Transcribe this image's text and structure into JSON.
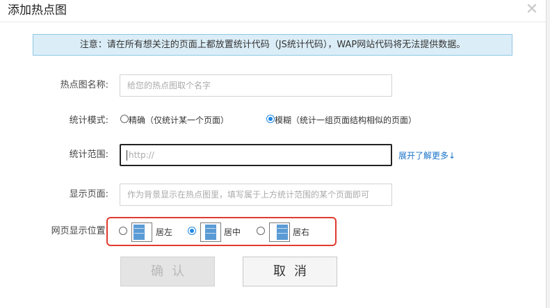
{
  "dialog": {
    "title": "添加热点图",
    "close_glyph": "✕"
  },
  "notice": {
    "text": "注意：请在所有想关注的页面上都放置统计代码（JS统计代码），WAP网站代码将无法提供数据。"
  },
  "form": {
    "name": {
      "label": "热点图名称:",
      "placeholder": "给您的热点图取个名字",
      "value": ""
    },
    "mode": {
      "label": "统计模式:",
      "options": [
        {
          "label": "精确（仅统计某一个页面）",
          "selected": false
        },
        {
          "label": "模糊（统计一组页面结构相似的页面）",
          "selected": true
        }
      ]
    },
    "range": {
      "label": "统计范围:",
      "placeholder": "http://",
      "value": "",
      "link_text": "展开了解更多↓"
    },
    "display_page": {
      "label": "显示页面:",
      "placeholder": "作为背景显示在热点图里，填写属于上方统计范围的某个页面即可",
      "value": ""
    },
    "position": {
      "label": "网页显示位置:",
      "options": [
        {
          "label": "居左",
          "icon": "align-left-layout-icon",
          "selected": false
        },
        {
          "label": "居中",
          "icon": "align-center-layout-icon",
          "selected": true
        },
        {
          "label": "居右",
          "icon": "align-right-layout-icon",
          "selected": false
        }
      ]
    }
  },
  "buttons": {
    "confirm": "确认",
    "cancel": "取消"
  },
  "colors": {
    "notice_bg": "#dbeef8",
    "notice_border": "#8fc5e3",
    "radio_accent": "#1e88e5",
    "link": "#1a73c9",
    "highlight_border": "#e03a2e",
    "layout_block": "#5b9bd5"
  }
}
